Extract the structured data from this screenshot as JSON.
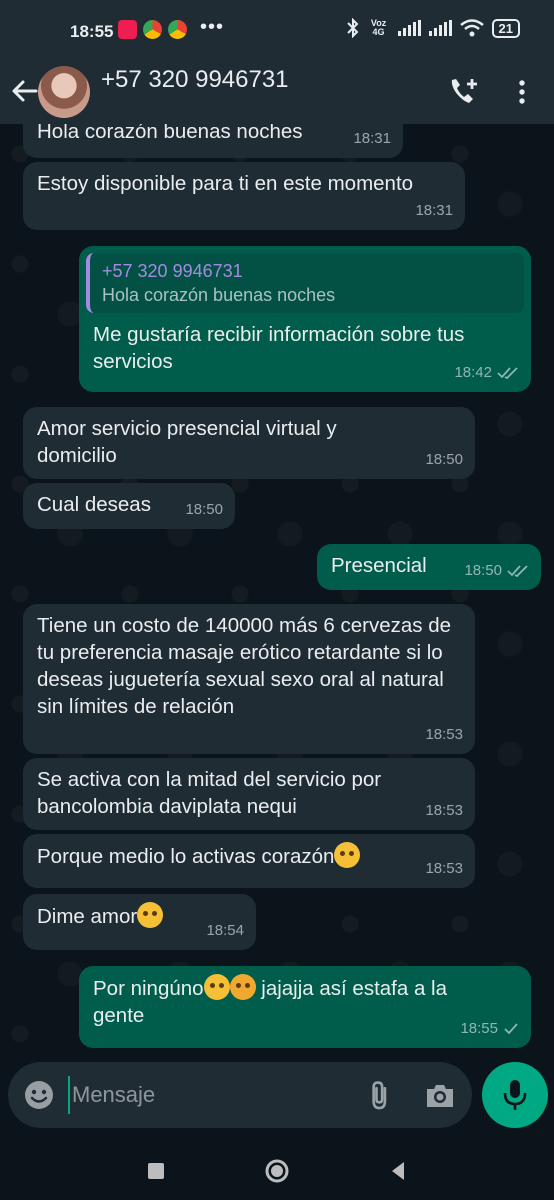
{
  "status_bar": {
    "time": "18:55",
    "network": "Voz 4G",
    "battery": "21"
  },
  "header": {
    "contact": "+57 320 9946731"
  },
  "messages": [
    {
      "dir": "in",
      "text": "Hola corazón buenas noches",
      "time": "18:31"
    },
    {
      "dir": "in",
      "text": "Estoy disponible para ti en este momento",
      "time": "18:31"
    },
    {
      "dir": "out",
      "quote_name": "+57 320 9946731",
      "quote_text": "Hola corazón buenas noches",
      "text": "Me gustaría recibir información sobre tus servicios",
      "time": "18:42",
      "status": "read"
    },
    {
      "dir": "in",
      "text": "Amor servicio presencial virtual y domicilio",
      "time": "18:50"
    },
    {
      "dir": "in",
      "text": "Cual deseas",
      "time": "18:50"
    },
    {
      "dir": "out",
      "text": "Presencial",
      "time": "18:50",
      "status": "read"
    },
    {
      "dir": "in",
      "text": "Tiene un costo de 140000 más 6 cervezas de tu preferencia masaje erótico retardante si lo deseas juguetería sexual sexo oral al natural sin límites de relación",
      "time": "18:53"
    },
    {
      "dir": "in",
      "text": "Se activa con la mitad del servicio por bancolombia daviplata nequi",
      "time": "18:53"
    },
    {
      "dir": "in",
      "text": "Porque medio lo activas corazón",
      "time": "18:53",
      "emoji": "kiss-emoji"
    },
    {
      "dir": "in",
      "text": "Dime amor",
      "time": "18:54",
      "emoji": "kiss-emoji"
    },
    {
      "dir": "out",
      "text_a": "Por ningúno",
      "text_b": " jajajja así estafa a la gente",
      "time": "18:55",
      "status": "sent",
      "emojis": [
        "eye-roll-emoji",
        "cursing-emoji"
      ]
    }
  ],
  "composer": {
    "placeholder": "Mensaje"
  },
  "colors": {
    "background": "#0b141a",
    "bar": "#1f2c34",
    "incoming": "#202c33",
    "outgoing": "#005c4b",
    "accent": "#00a884",
    "quote_name": "#a58ae2"
  }
}
